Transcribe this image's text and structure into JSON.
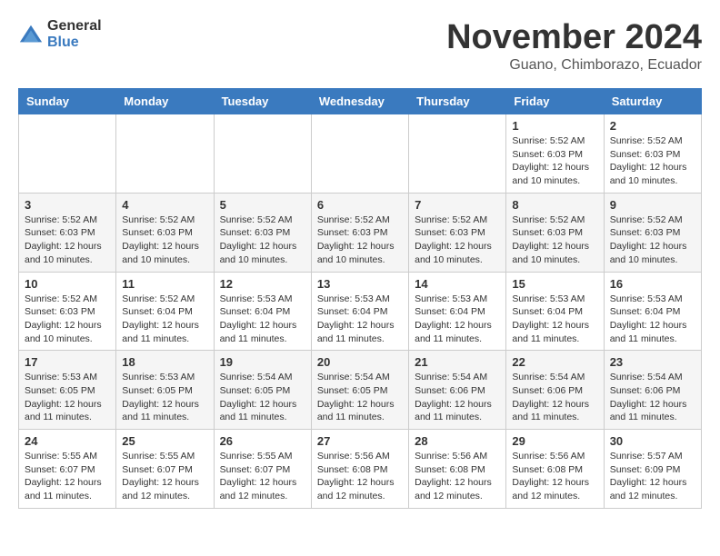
{
  "logo": {
    "general": "General",
    "blue": "Blue"
  },
  "title": {
    "month": "November 2024",
    "location": "Guano, Chimborazo, Ecuador"
  },
  "headers": [
    "Sunday",
    "Monday",
    "Tuesday",
    "Wednesday",
    "Thursday",
    "Friday",
    "Saturday"
  ],
  "weeks": [
    [
      {
        "day": "",
        "info": ""
      },
      {
        "day": "",
        "info": ""
      },
      {
        "day": "",
        "info": ""
      },
      {
        "day": "",
        "info": ""
      },
      {
        "day": "",
        "info": ""
      },
      {
        "day": "1",
        "info": "Sunrise: 5:52 AM\nSunset: 6:03 PM\nDaylight: 12 hours\nand 10 minutes."
      },
      {
        "day": "2",
        "info": "Sunrise: 5:52 AM\nSunset: 6:03 PM\nDaylight: 12 hours\nand 10 minutes."
      }
    ],
    [
      {
        "day": "3",
        "info": "Sunrise: 5:52 AM\nSunset: 6:03 PM\nDaylight: 12 hours\nand 10 minutes."
      },
      {
        "day": "4",
        "info": "Sunrise: 5:52 AM\nSunset: 6:03 PM\nDaylight: 12 hours\nand 10 minutes."
      },
      {
        "day": "5",
        "info": "Sunrise: 5:52 AM\nSunset: 6:03 PM\nDaylight: 12 hours\nand 10 minutes."
      },
      {
        "day": "6",
        "info": "Sunrise: 5:52 AM\nSunset: 6:03 PM\nDaylight: 12 hours\nand 10 minutes."
      },
      {
        "day": "7",
        "info": "Sunrise: 5:52 AM\nSunset: 6:03 PM\nDaylight: 12 hours\nand 10 minutes."
      },
      {
        "day": "8",
        "info": "Sunrise: 5:52 AM\nSunset: 6:03 PM\nDaylight: 12 hours\nand 10 minutes."
      },
      {
        "day": "9",
        "info": "Sunrise: 5:52 AM\nSunset: 6:03 PM\nDaylight: 12 hours\nand 10 minutes."
      }
    ],
    [
      {
        "day": "10",
        "info": "Sunrise: 5:52 AM\nSunset: 6:03 PM\nDaylight: 12 hours\nand 10 minutes."
      },
      {
        "day": "11",
        "info": "Sunrise: 5:52 AM\nSunset: 6:04 PM\nDaylight: 12 hours\nand 11 minutes."
      },
      {
        "day": "12",
        "info": "Sunrise: 5:53 AM\nSunset: 6:04 PM\nDaylight: 12 hours\nand 11 minutes."
      },
      {
        "day": "13",
        "info": "Sunrise: 5:53 AM\nSunset: 6:04 PM\nDaylight: 12 hours\nand 11 minutes."
      },
      {
        "day": "14",
        "info": "Sunrise: 5:53 AM\nSunset: 6:04 PM\nDaylight: 12 hours\nand 11 minutes."
      },
      {
        "day": "15",
        "info": "Sunrise: 5:53 AM\nSunset: 6:04 PM\nDaylight: 12 hours\nand 11 minutes."
      },
      {
        "day": "16",
        "info": "Sunrise: 5:53 AM\nSunset: 6:04 PM\nDaylight: 12 hours\nand 11 minutes."
      }
    ],
    [
      {
        "day": "17",
        "info": "Sunrise: 5:53 AM\nSunset: 6:05 PM\nDaylight: 12 hours\nand 11 minutes."
      },
      {
        "day": "18",
        "info": "Sunrise: 5:53 AM\nSunset: 6:05 PM\nDaylight: 12 hours\nand 11 minutes."
      },
      {
        "day": "19",
        "info": "Sunrise: 5:54 AM\nSunset: 6:05 PM\nDaylight: 12 hours\nand 11 minutes."
      },
      {
        "day": "20",
        "info": "Sunrise: 5:54 AM\nSunset: 6:05 PM\nDaylight: 12 hours\nand 11 minutes."
      },
      {
        "day": "21",
        "info": "Sunrise: 5:54 AM\nSunset: 6:06 PM\nDaylight: 12 hours\nand 11 minutes."
      },
      {
        "day": "22",
        "info": "Sunrise: 5:54 AM\nSunset: 6:06 PM\nDaylight: 12 hours\nand 11 minutes."
      },
      {
        "day": "23",
        "info": "Sunrise: 5:54 AM\nSunset: 6:06 PM\nDaylight: 12 hours\nand 11 minutes."
      }
    ],
    [
      {
        "day": "24",
        "info": "Sunrise: 5:55 AM\nSunset: 6:07 PM\nDaylight: 12 hours\nand 11 minutes."
      },
      {
        "day": "25",
        "info": "Sunrise: 5:55 AM\nSunset: 6:07 PM\nDaylight: 12 hours\nand 12 minutes."
      },
      {
        "day": "26",
        "info": "Sunrise: 5:55 AM\nSunset: 6:07 PM\nDaylight: 12 hours\nand 12 minutes."
      },
      {
        "day": "27",
        "info": "Sunrise: 5:56 AM\nSunset: 6:08 PM\nDaylight: 12 hours\nand 12 minutes."
      },
      {
        "day": "28",
        "info": "Sunrise: 5:56 AM\nSunset: 6:08 PM\nDaylight: 12 hours\nand 12 minutes."
      },
      {
        "day": "29",
        "info": "Sunrise: 5:56 AM\nSunset: 6:08 PM\nDaylight: 12 hours\nand 12 minutes."
      },
      {
        "day": "30",
        "info": "Sunrise: 5:57 AM\nSunset: 6:09 PM\nDaylight: 12 hours\nand 12 minutes."
      }
    ]
  ]
}
